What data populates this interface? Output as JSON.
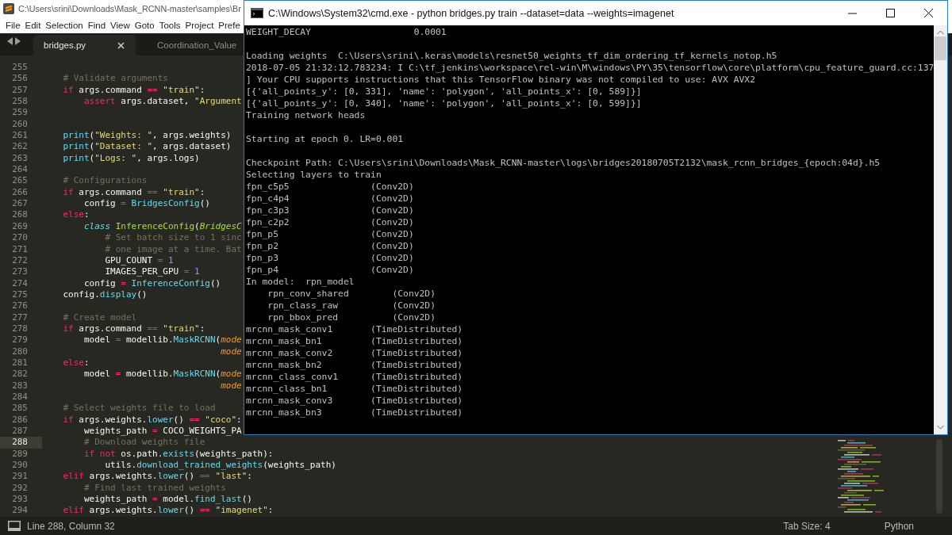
{
  "editor": {
    "title": "C:\\Users\\srini\\Downloads\\Mask_RCNN-master\\samples\\Br",
    "menu": [
      "File",
      "Edit",
      "Selection",
      "Find",
      "View",
      "Goto",
      "Tools",
      "Project",
      "Prefe"
    ],
    "tabs": [
      {
        "label": "bridges.py",
        "selected": true
      },
      {
        "label": "Coordination_Value",
        "selected": false
      }
    ],
    "lines": [
      {
        "number": "255",
        "current": false
      },
      {
        "number": "256",
        "current": false,
        "tokens": [
          {
            "kind": "comment",
            "text": "    # Validate arguments"
          }
        ]
      },
      {
        "number": "257",
        "current": false,
        "tokens": [
          {
            "kind": "keyword",
            "text": "    if"
          },
          {
            "kind": "plain",
            "text": " args.command "
          },
          {
            "kind": "keyword",
            "text": "== "
          },
          {
            "kind": "string",
            "text": "\"train\""
          },
          {
            "kind": "plain",
            "text": ":"
          }
        ]
      },
      {
        "number": "258",
        "current": false,
        "tokens": [
          {
            "kind": "keyword",
            "text": "        assert"
          },
          {
            "kind": "plain",
            "text": " args.dataset, "
          },
          {
            "kind": "string",
            "text": "\"Argument"
          }
        ]
      },
      {
        "number": "259",
        "current": false
      },
      {
        "number": "260",
        "current": false
      },
      {
        "number": "261",
        "current": false,
        "tokens": [
          {
            "kind": "function",
            "text": "    print"
          },
          {
            "kind": "plain",
            "text": "("
          },
          {
            "kind": "string",
            "text": "\"Weights: \""
          },
          {
            "kind": "plain",
            "text": ", args.weights)"
          }
        ]
      },
      {
        "number": "262",
        "current": false,
        "tokens": [
          {
            "kind": "function",
            "text": "    print"
          },
          {
            "kind": "plain",
            "text": "("
          },
          {
            "kind": "string",
            "text": "\"Dataset: \""
          },
          {
            "kind": "plain",
            "text": ", args.dataset)"
          }
        ]
      },
      {
        "number": "263",
        "current": false,
        "tokens": [
          {
            "kind": "function",
            "text": "    print"
          },
          {
            "kind": "plain",
            "text": "("
          },
          {
            "kind": "string",
            "text": "\"Logs: \""
          },
          {
            "kind": "plain",
            "text": ", args.logs)"
          }
        ]
      },
      {
        "number": "264",
        "current": false
      },
      {
        "number": "265",
        "current": false,
        "tokens": [
          {
            "kind": "comment",
            "text": "    # Configurations"
          }
        ]
      },
      {
        "number": "266",
        "current": false,
        "tokens": [
          {
            "kind": "keyword",
            "text": "    if"
          },
          {
            "kind": "plain",
            "text": " args.command "
          },
          {
            "kind": "keyword",
            "text": "== "
          },
          {
            "kind": "string",
            "text": "\"train\""
          },
          {
            "kind": "plain",
            "text": ":"
          }
        ]
      },
      {
        "number": "267",
        "current": false,
        "tokens": [
          {
            "kind": "plain",
            "text": "        config "
          },
          {
            "kind": "keyword",
            "text": "= "
          },
          {
            "kind": "function",
            "text": "BridgesConfig"
          },
          {
            "kind": "plain",
            "text": "()"
          }
        ]
      },
      {
        "number": "268",
        "current": false,
        "tokens": [
          {
            "kind": "keyword",
            "text": "    else"
          },
          {
            "kind": "plain",
            "text": ":"
          }
        ]
      },
      {
        "number": "269",
        "current": false,
        "tokens": [
          {
            "kind": "storage",
            "text": "        class "
          },
          {
            "kind": "classname",
            "text": "InferenceConfig"
          },
          {
            "kind": "plain",
            "text": "("
          },
          {
            "kind": "inherit",
            "text": "BridgesC"
          }
        ]
      },
      {
        "number": "270",
        "current": false,
        "tokens": [
          {
            "kind": "comment",
            "text": "            # Set batch size to 1 sinc"
          }
        ]
      },
      {
        "number": "271",
        "current": false,
        "tokens": [
          {
            "kind": "comment",
            "text": "            # one image at a time. Bat"
          }
        ]
      },
      {
        "number": "272",
        "current": false,
        "tokens": [
          {
            "kind": "plain",
            "text": "            GPU_COUNT "
          },
          {
            "kind": "keyword",
            "text": "= "
          },
          {
            "kind": "number",
            "text": "1"
          }
        ]
      },
      {
        "number": "273",
        "current": false,
        "tokens": [
          {
            "kind": "plain",
            "text": "            IMAGES_PER_GPU "
          },
          {
            "kind": "keyword",
            "text": "= "
          },
          {
            "kind": "number",
            "text": "1"
          }
        ]
      },
      {
        "number": "274",
        "current": false,
        "tokens": [
          {
            "kind": "plain",
            "text": "        config "
          },
          {
            "kind": "keyword",
            "text": "= "
          },
          {
            "kind": "function",
            "text": "InferenceConfig"
          },
          {
            "kind": "plain",
            "text": "()"
          }
        ]
      },
      {
        "number": "275",
        "current": false,
        "tokens": [
          {
            "kind": "plain",
            "text": "    config."
          },
          {
            "kind": "function",
            "text": "display"
          },
          {
            "kind": "plain",
            "text": "()"
          }
        ]
      },
      {
        "number": "276",
        "current": false
      },
      {
        "number": "277",
        "current": false,
        "tokens": [
          {
            "kind": "comment",
            "text": "    # Create model"
          }
        ]
      },
      {
        "number": "278",
        "current": false,
        "tokens": [
          {
            "kind": "keyword",
            "text": "    if"
          },
          {
            "kind": "plain",
            "text": " args.command "
          },
          {
            "kind": "keyword",
            "text": "== "
          },
          {
            "kind": "string",
            "text": "\"train\""
          },
          {
            "kind": "plain",
            "text": ":"
          }
        ]
      },
      {
        "number": "279",
        "current": false,
        "tokens": [
          {
            "kind": "plain",
            "text": "        model "
          },
          {
            "kind": "keyword",
            "text": "="
          },
          {
            "kind": "plain",
            "text": " modellib."
          },
          {
            "kind": "function",
            "text": "MaskRCNN"
          },
          {
            "kind": "plain",
            "text": "("
          },
          {
            "kind": "parameter",
            "text": "mode"
          }
        ]
      },
      {
        "number": "280",
        "current": false,
        "tokens": [
          {
            "kind": "parameter",
            "text": "                                  mode"
          }
        ]
      },
      {
        "number": "281",
        "current": false,
        "tokens": [
          {
            "kind": "keyword",
            "text": "    else"
          },
          {
            "kind": "plain",
            "text": ":"
          }
        ]
      },
      {
        "number": "282",
        "current": false,
        "tokens": [
          {
            "kind": "plain",
            "text": "        model "
          },
          {
            "kind": "keyword",
            "text": "="
          },
          {
            "kind": "plain",
            "text": " modellib."
          },
          {
            "kind": "function",
            "text": "MaskRCNN"
          },
          {
            "kind": "plain",
            "text": "("
          },
          {
            "kind": "parameter",
            "text": "mode"
          }
        ]
      },
      {
        "number": "283",
        "current": false,
        "tokens": [
          {
            "kind": "parameter",
            "text": "                                  mode"
          }
        ]
      },
      {
        "number": "284",
        "current": false
      },
      {
        "number": "285",
        "current": false,
        "tokens": [
          {
            "kind": "comment",
            "text": "    # Select weights file to load"
          }
        ]
      },
      {
        "number": "286",
        "current": false,
        "tokens": [
          {
            "kind": "keyword",
            "text": "    if"
          },
          {
            "kind": "plain",
            "text": " args.weights."
          },
          {
            "kind": "function",
            "text": "lower"
          },
          {
            "kind": "plain",
            "text": "() "
          },
          {
            "kind": "keyword",
            "text": "== "
          },
          {
            "kind": "string",
            "text": "\"coco\""
          },
          {
            "kind": "plain",
            "text": ":"
          }
        ]
      },
      {
        "number": "287",
        "current": false,
        "tokens": [
          {
            "kind": "plain",
            "text": "        weights_path "
          },
          {
            "kind": "keyword",
            "text": "="
          },
          {
            "kind": "plain",
            "text": " COCO_WEIGHTS_PA"
          }
        ]
      },
      {
        "number": "288",
        "current": true,
        "tokens": [
          {
            "kind": "comment",
            "text": "        # Download weights file"
          }
        ]
      },
      {
        "number": "289",
        "current": false,
        "tokens": [
          {
            "kind": "keyword",
            "text": "        if not"
          },
          {
            "kind": "plain",
            "text": " os.path."
          },
          {
            "kind": "function",
            "text": "exists"
          },
          {
            "kind": "plain",
            "text": "(weights_path):"
          }
        ]
      },
      {
        "number": "290",
        "current": false,
        "tokens": [
          {
            "kind": "plain",
            "text": "            utils."
          },
          {
            "kind": "function",
            "text": "download_trained_weights"
          },
          {
            "kind": "plain",
            "text": "(weights_path)"
          }
        ]
      },
      {
        "number": "291",
        "current": false,
        "tokens": [
          {
            "kind": "keyword",
            "text": "    elif"
          },
          {
            "kind": "plain",
            "text": " args.weights."
          },
          {
            "kind": "function",
            "text": "lower"
          },
          {
            "kind": "plain",
            "text": "() "
          },
          {
            "kind": "keyword",
            "text": "== "
          },
          {
            "kind": "string",
            "text": "\"last\""
          },
          {
            "kind": "plain",
            "text": ":"
          }
        ]
      },
      {
        "number": "292",
        "current": false,
        "tokens": [
          {
            "kind": "comment",
            "text": "        # Find last trained weights"
          }
        ]
      },
      {
        "number": "293",
        "current": false,
        "tokens": [
          {
            "kind": "plain",
            "text": "        weights_path "
          },
          {
            "kind": "keyword",
            "text": "="
          },
          {
            "kind": "plain",
            "text": " model."
          },
          {
            "kind": "function",
            "text": "find_last"
          },
          {
            "kind": "plain",
            "text": "()"
          }
        ]
      },
      {
        "number": "294",
        "current": false,
        "tokens": [
          {
            "kind": "keyword",
            "text": "    elif"
          },
          {
            "kind": "plain",
            "text": " args.weights."
          },
          {
            "kind": "function",
            "text": "lower"
          },
          {
            "kind": "plain",
            "text": "() "
          },
          {
            "kind": "keyword",
            "text": "== "
          },
          {
            "kind": "string",
            "text": "\"imagenet\""
          },
          {
            "kind": "plain",
            "text": ":"
          }
        ]
      }
    ]
  },
  "console": {
    "title": "C:\\Windows\\System32\\cmd.exe - python  bridges.py train --dataset=data  --weights=imagenet",
    "blocks": [
      [
        "WEIGHT_DECAY                   0.0001"
      ],
      [
        "Loading weights  C:\\Users\\srini\\.keras\\models\\resnet50_weights_tf_dim_ordering_tf_kernels_notop.h5",
        "2018-07-05 21:32:12.783234: I C:\\tf_jenkins\\workspace\\rel-win\\M\\windows\\PY\\35\\tensorflow\\core\\platform\\cpu_feature_guard.cc:137",
        "] Your CPU supports instructions that this TensorFlow binary was not compiled to use: AVX AVX2",
        "[{'all_points_y': [0, 331], 'name': 'polygon', 'all_points_x': [0, 589]}]",
        "[{'all_points_y': [0, 340], 'name': 'polygon', 'all_points_x': [0, 599]}]",
        "Training network heads"
      ],
      [
        "Starting at epoch 0. LR=0.001"
      ],
      [
        "Checkpoint Path: C:\\Users\\srini\\Downloads\\Mask_RCNN-master\\logs\\bridges20180705T2132\\mask_rcnn_bridges_{epoch:04d}.h5",
        "Selecting layers to train",
        "fpn_c5p5               (Conv2D)",
        "fpn_c4p4               (Conv2D)",
        "fpn_c3p3               (Conv2D)",
        "fpn_c2p2               (Conv2D)",
        "fpn_p5                 (Conv2D)",
        "fpn_p2                 (Conv2D)",
        "fpn_p3                 (Conv2D)",
        "fpn_p4                 (Conv2D)",
        "In model:  rpn_model",
        "    rpn_conv_shared        (Conv2D)",
        "    rpn_class_raw          (Conv2D)",
        "    rpn_bbox_pred          (Conv2D)",
        "mrcnn_mask_conv1       (TimeDistributed)",
        "mrcnn_mask_bn1         (TimeDistributed)",
        "mrcnn_mask_conv2       (TimeDistributed)",
        "mrcnn_mask_bn2         (TimeDistributed)",
        "mrcnn_class_conv1      (TimeDistributed)",
        "mrcnn_class_bn1        (TimeDistributed)",
        "mrcnn_mask_conv3       (TimeDistributed)",
        "mrcnn_mask_bn3         (TimeDistributed)"
      ]
    ]
  },
  "status_bar": {
    "position": "Line 288, Column 32",
    "tab_size": "Tab Size: 4",
    "syntax": "Python"
  }
}
